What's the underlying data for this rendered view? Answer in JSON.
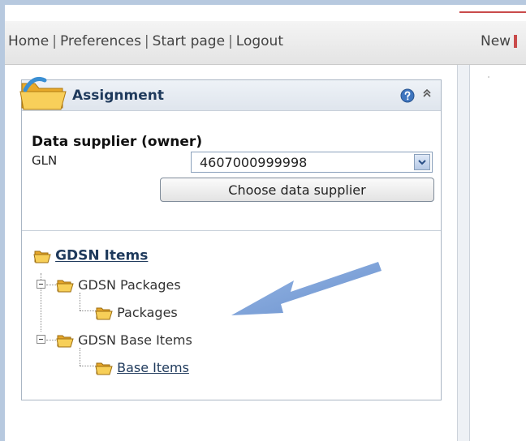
{
  "nav": {
    "links": [
      "Home",
      "Preferences",
      "Start page",
      "Logout"
    ],
    "separator": "|",
    "new_label": "New"
  },
  "panel": {
    "title": "Assignment",
    "help_icon": "help-icon",
    "collapse_icon": "collapse-chevron-icon"
  },
  "owner": {
    "title": "Data supplier (owner)",
    "gln_label": "GLN",
    "gln_value": "4607000999998",
    "choose_button": "Choose data supplier"
  },
  "tree": {
    "root": "GDSN Items",
    "groups": [
      {
        "label": "GDSN Packages",
        "child": "Packages"
      },
      {
        "label": "GDSN Base Items",
        "child": "Base Items"
      }
    ]
  },
  "colors": {
    "link": "#1f3a5c",
    "folder": "#f2c24a",
    "annotation_arrow": "#6f97d4",
    "outer_frame": "#b7c9df"
  }
}
